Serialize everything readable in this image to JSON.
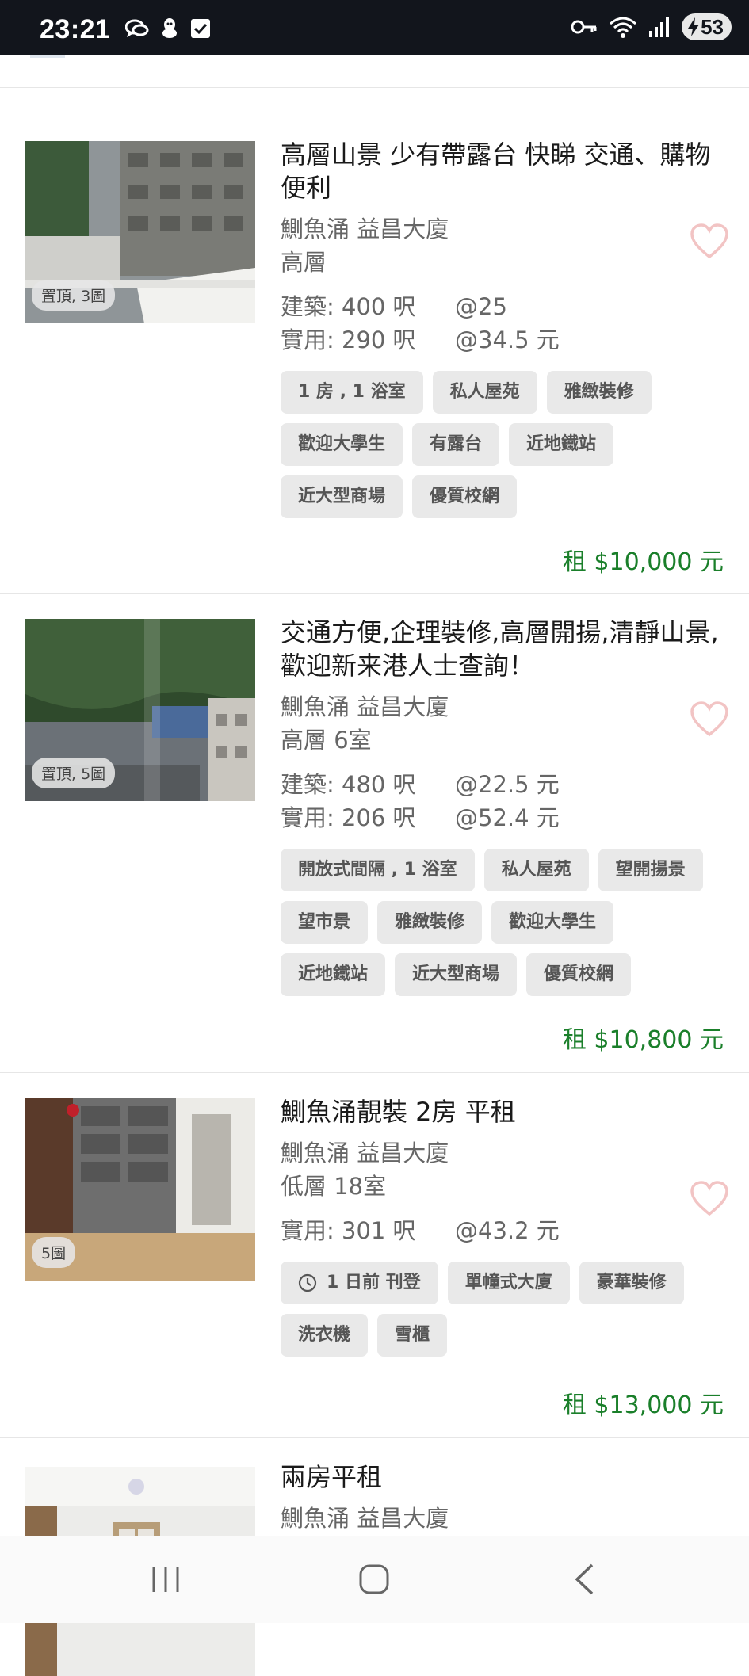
{
  "status_bar": {
    "time": "23:21",
    "battery_level": "53",
    "left_icons": [
      "wechat-icon",
      "qq-icon",
      "checkbox-icon"
    ],
    "right_icons": [
      "vpn-key-icon",
      "wifi-icon",
      "signal-icon",
      "battery-icon"
    ]
  },
  "listings": [
    {
      "title": "高層山景 少有帶露台 快睇 交通、購物便利",
      "location": "鰂魚涌 益昌大廈",
      "floor": "高層",
      "areas": [
        {
          "label": "建築: 400 呎",
          "unit_price": "@25"
        },
        {
          "label": "實用: 290 呎",
          "unit_price": "@34.5 元"
        }
      ],
      "tags": [
        "1 房 , 1 浴室",
        "私人屋苑",
        "雅緻裝修",
        "歡迎大學生",
        "有露台",
        "近地鐵站",
        "近大型商場",
        "優質校網"
      ],
      "price": "租 $10,000 元",
      "photo_badge": "置頂, 3圖",
      "favorited": false
    },
    {
      "title": "交通方便,企理裝修,高層開揚,清靜山景,歡迎新来港人士查詢！",
      "location": "鰂魚涌 益昌大廈",
      "floor": "高層 6室",
      "areas": [
        {
          "label": "建築: 480 呎",
          "unit_price": "@22.5 元"
        },
        {
          "label": "實用: 206 呎",
          "unit_price": "@52.4 元"
        }
      ],
      "tags": [
        "開放式間隔 , 1 浴室",
        "私人屋苑",
        "望開揚景",
        "望市景",
        "雅緻裝修",
        "歡迎大學生",
        "近地鐵站",
        "近大型商場",
        "優質校網"
      ],
      "price": "租 $10,800 元",
      "photo_badge": "置頂, 5圖",
      "favorited": false
    },
    {
      "title": "鰂魚涌靚裝 2房 平租",
      "location": "鰂魚涌 益昌大廈",
      "floor": "低層 18室",
      "areas": [
        {
          "label": "實用: 301 呎",
          "unit_price": "@43.2 元"
        }
      ],
      "tags": [
        "1 日前 刊登",
        "單幢式大廈",
        "豪華裝修",
        "洗衣機",
        "雪櫃"
      ],
      "price": "租 $13,000 元",
      "photo_badge": "5圖",
      "favorited": false
    },
    {
      "title": "兩房平租",
      "location": "鰂魚涌 益昌大廈",
      "floor": "",
      "areas": [],
      "tags": [],
      "price": "",
      "photo_badge": "",
      "favorited": false
    }
  ],
  "colors": {
    "price_green": "#1a7f2a",
    "heart_pink": "#f2c4c4",
    "tag_bg": "#e9e9e9",
    "status_bar_bg": "#12151c"
  }
}
